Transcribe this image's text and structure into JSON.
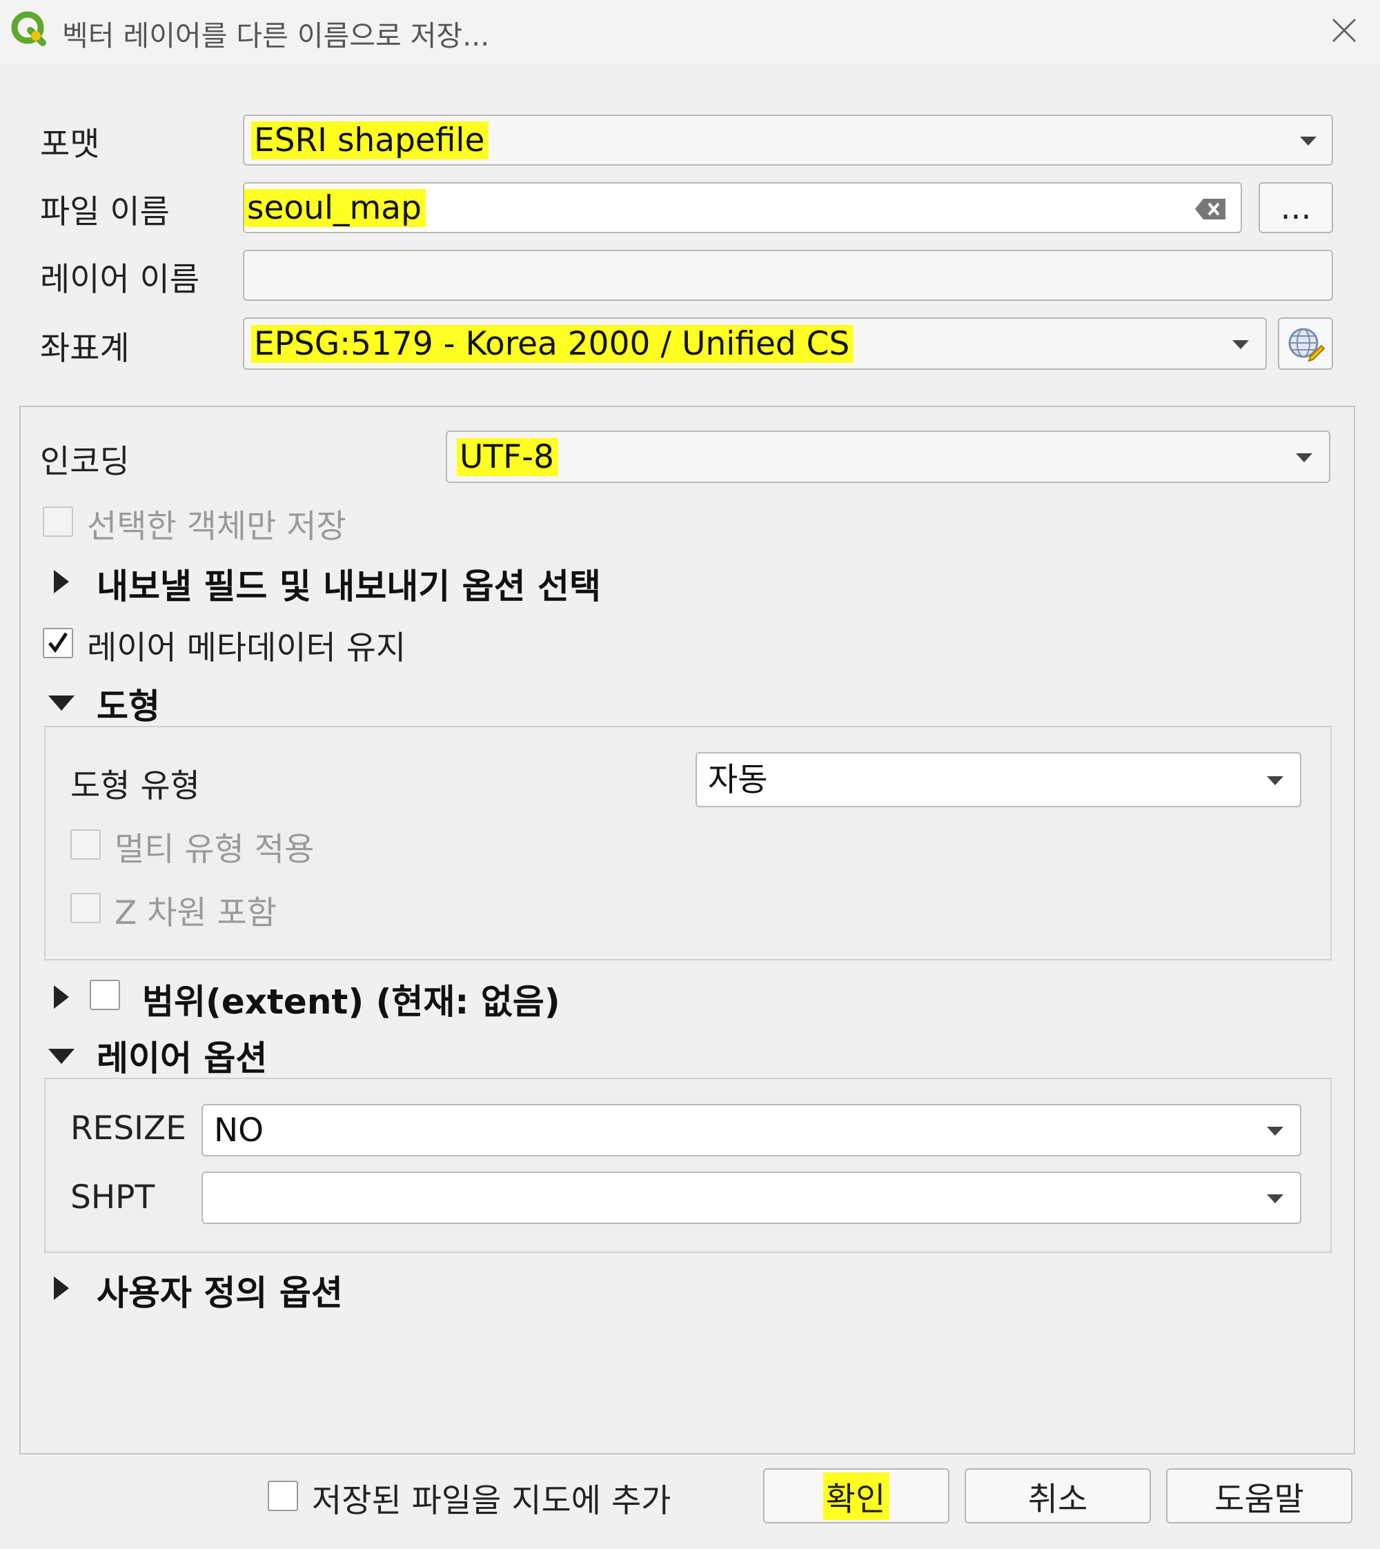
{
  "window": {
    "title": "벡터 레이어를 다른 이름으로 저장..."
  },
  "form": {
    "format_label": "포맷",
    "format_value": "ESRI shapefile",
    "filename_label": "파일 이름",
    "filename_value": "seoul_map",
    "browse_label": "...",
    "layername_label": "레이어 이름",
    "layername_value": "",
    "crs_label": "좌표계",
    "crs_value": "EPSG:5179 - Korea 2000 / Unified CS"
  },
  "options": {
    "encoding_label": "인코딩",
    "encoding_value": "UTF-8",
    "selected_only_label": "선택한 객체만 저장",
    "selected_only_checked": false,
    "fields_section": "내보낼 필드 및 내보내기 옵션 선택",
    "keep_metadata_label": "레이어 메타데이터 유지",
    "keep_metadata_checked": true,
    "geometry_section": "도형",
    "geometry_type_label": "도형 유형",
    "geometry_type_value": "자동",
    "force_multi_label": "멀티 유형 적용",
    "include_z_label": "Z 차원 포함",
    "extent_section": "범위(extent) (현재: 없음)",
    "layer_options_section": "레이어 옵션",
    "resize_label": "RESIZE",
    "resize_value": "NO",
    "shpt_label": "SHPT",
    "shpt_value": "",
    "custom_options_section": "사용자 정의 옵션"
  },
  "footer": {
    "add_to_map_label": "저장된 파일을 지도에 추가",
    "ok_label": "확인",
    "cancel_label": "취소",
    "help_label": "도움말"
  },
  "colors": {
    "highlight": "#ffff22",
    "logo_green": "#5fa82f",
    "logo_yellow": "#f1c200"
  },
  "icons": [
    "qgis-logo-icon",
    "close-icon",
    "clear-icon",
    "dropdown-arrow-icon",
    "globe-crs-icon",
    "expand-arrow-icon",
    "collapse-arrow-icon",
    "checkbox-icon"
  ]
}
